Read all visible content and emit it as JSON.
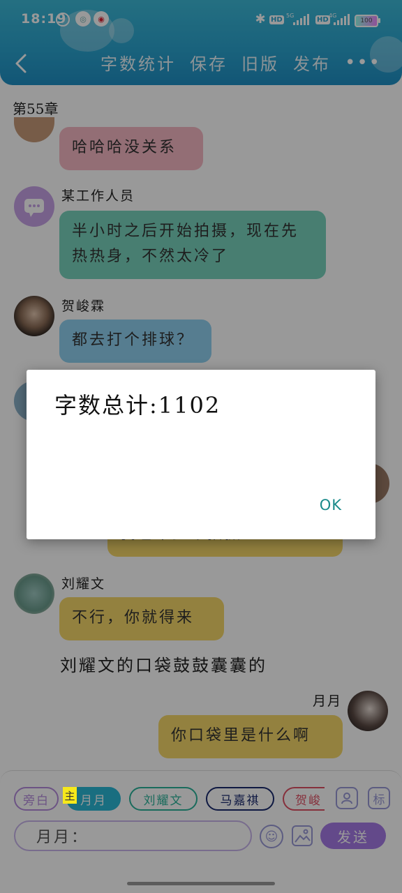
{
  "status_bar": {
    "time": "18:19",
    "network_1": "5G",
    "network_2": "4G",
    "hd_label": "HD",
    "battery_label": "100"
  },
  "header": {
    "back_icon": "chevron-left-icon",
    "actions": [
      "字数统计",
      "保存",
      "旧版",
      "发布"
    ],
    "more_icon": "ellipsis-icon",
    "accent_color": "#2aa3cf"
  },
  "chapter_title": "第55章",
  "messages": [
    {
      "text": "哈哈哈没关系",
      "color": "#f6b7c4"
    },
    {
      "sender": "某工作人员",
      "text": "半小时之后开始拍摄，现在先热热身，不然太冷了",
      "color": "#79d3bd"
    },
    {
      "sender": "贺峻霖",
      "text": "都去打个排球？",
      "color": "#8fd0f0"
    },
    {
      "text": "我也不少今拍摄",
      "color": "#f6d86a"
    },
    {
      "sender": "刘耀文",
      "text": "不行，你就得来",
      "color": "#f6d86a"
    },
    {
      "narration": "刘耀文的口袋鼓鼓囊囊的"
    },
    {
      "sender": "月月",
      "text": "你口袋里是什么啊",
      "color": "#f6d86a"
    }
  ],
  "character_chips": [
    {
      "label": "旁白",
      "color": "#b48bdd"
    },
    {
      "label": "月月",
      "color": "#2bb8d6"
    },
    {
      "label": "刘耀文",
      "color": "#2bb39a"
    },
    {
      "label": "马嘉祺",
      "color": "#1a2a6e"
    },
    {
      "label": "贺峻",
      "color": "#e05064"
    }
  ],
  "main_tag": "主",
  "side_icons": {
    "person": "person-icon",
    "tag": "标"
  },
  "input": {
    "value": "月月："
  },
  "send_label": "发送",
  "dialog": {
    "message": "字数总计:1102",
    "ok_label": "OK"
  }
}
